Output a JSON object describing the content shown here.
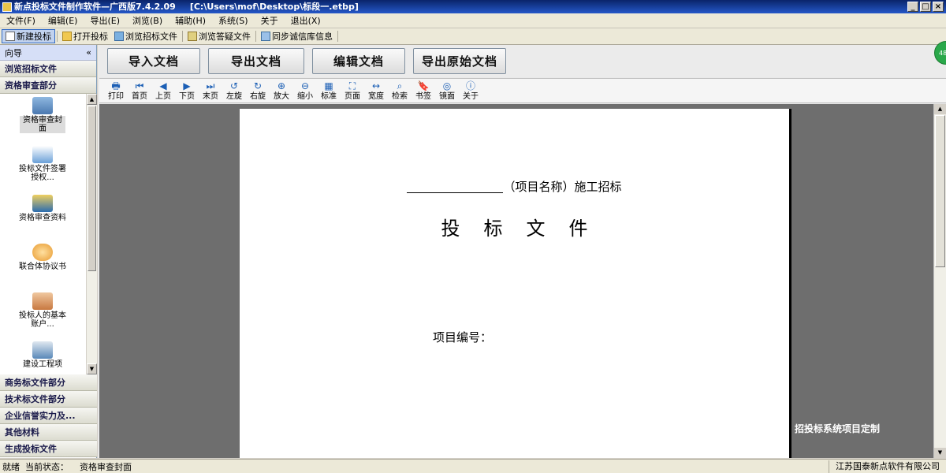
{
  "window": {
    "title": "新点投标文件制作软件—广西版7.4.2.09",
    "path": "[C:\\Users\\mof\\Desktop\\标段一.etbp]",
    "controls": [
      "_",
      "□",
      "×"
    ]
  },
  "menu": [
    "文件(F)",
    "编辑(E)",
    "导出(E)",
    "浏览(B)",
    "辅助(H)",
    "系统(S)",
    "关于",
    "退出(X)"
  ],
  "toolbar": [
    {
      "label": "新建投标",
      "icon": "new-document-icon"
    },
    {
      "label": "打开投标",
      "icon": "open-folder-icon"
    },
    {
      "label": "浏览招标文件",
      "icon": "browse-bid-icon"
    },
    {
      "label": "浏览答疑文件",
      "icon": "browse-qa-icon"
    },
    {
      "label": "同步诚信库信息",
      "icon": "sync-icon"
    }
  ],
  "sidebar": {
    "header": "向导",
    "collapse": "«",
    "top_sections": [
      "浏览招标文件",
      "资格审查部分"
    ],
    "items": [
      {
        "label": "资格审查封面",
        "icon": "cover-icon",
        "color": "#4a78b0"
      },
      {
        "label": "投标文件签署授权...",
        "icon": "sign-icon",
        "color": "#6aa0d8"
      },
      {
        "label": "资格审查资料",
        "icon": "materials-icon",
        "color": "#2a6cb0"
      },
      {
        "label": "联合体协议书",
        "icon": "agreement-icon",
        "color": "#e89a30"
      },
      {
        "label": "投标人的基本账户...",
        "icon": "account-icon",
        "color": "#c87840"
      },
      {
        "label": "建设工程项",
        "icon": "project-icon",
        "color": "#5888b8"
      }
    ],
    "bottom_sections": [
      "商务标文件部分",
      "技术标文件部分",
      "企业信誉实力及...",
      "其他材料",
      "生成投标文件"
    ]
  },
  "doc_buttons": [
    "导入文档",
    "导出文档",
    "编辑文档",
    "导出原始文档"
  ],
  "viewer_tools": [
    {
      "label": "打印",
      "icon": "print-icon",
      "glyph": "🖶"
    },
    {
      "label": "首页",
      "icon": "first-page-icon",
      "glyph": "⏮"
    },
    {
      "label": "上页",
      "icon": "prev-page-icon",
      "glyph": "◀"
    },
    {
      "label": "下页",
      "icon": "next-page-icon",
      "glyph": "▶"
    },
    {
      "label": "末页",
      "icon": "last-page-icon",
      "glyph": "⏭"
    },
    {
      "label": "左旋",
      "icon": "rotate-left-icon",
      "glyph": "↺"
    },
    {
      "label": "右旋",
      "icon": "rotate-right-icon",
      "glyph": "↻"
    },
    {
      "label": "放大",
      "icon": "zoom-in-icon",
      "glyph": "⊕"
    },
    {
      "label": "缩小",
      "icon": "zoom-out-icon",
      "glyph": "⊖"
    },
    {
      "label": "标准",
      "icon": "standard-icon",
      "glyph": "▦"
    },
    {
      "label": "页面",
      "icon": "fit-page-icon",
      "glyph": "⛶"
    },
    {
      "label": "宽度",
      "icon": "fit-width-icon",
      "glyph": "↔"
    },
    {
      "label": "检索",
      "icon": "search-icon",
      "glyph": "⌕"
    },
    {
      "label": "书签",
      "icon": "bookmark-icon",
      "glyph": "🔖"
    },
    {
      "label": "镜面",
      "icon": "mirror-icon",
      "glyph": "◎"
    },
    {
      "label": "关于",
      "icon": "about-icon",
      "glyph": "ⓘ"
    }
  ],
  "document": {
    "line1_suffix": "（项目名称）施工招标",
    "title": "投标文件",
    "project_no": "项目编号："
  },
  "watermark": "招投标系统项目定制",
  "status": {
    "ready": "就绪",
    "state_label": "当前状态：",
    "state_value": "资格审查封面",
    "company": "江苏国泰新点软件有限公司"
  },
  "badge": "48"
}
